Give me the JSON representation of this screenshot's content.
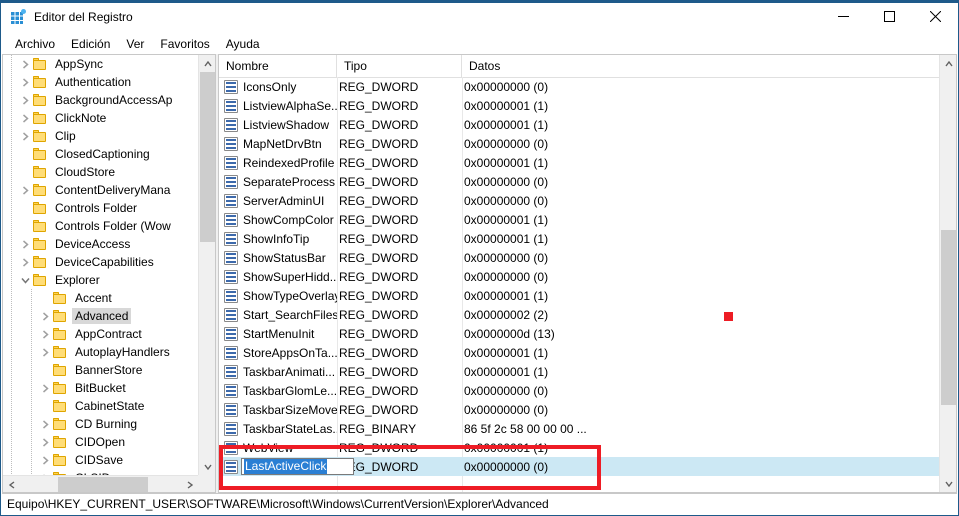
{
  "window": {
    "title": "Editor del Registro",
    "icon": "registry-editor-icon",
    "controls": {
      "minimize": "—",
      "maximize": "□",
      "close": "✕"
    }
  },
  "menu": {
    "items": [
      "Archivo",
      "Edición",
      "Ver",
      "Favoritos",
      "Ayuda"
    ]
  },
  "tree": {
    "items": [
      {
        "label": "AppSync",
        "depth": 2,
        "expandable": true,
        "expanded": false,
        "selected": false
      },
      {
        "label": "Authentication",
        "depth": 2,
        "expandable": true,
        "expanded": false,
        "selected": false
      },
      {
        "label": "BackgroundAccessAp",
        "depth": 2,
        "expandable": true,
        "expanded": false,
        "selected": false
      },
      {
        "label": "ClickNote",
        "depth": 2,
        "expandable": true,
        "expanded": false,
        "selected": false
      },
      {
        "label": "Clip",
        "depth": 2,
        "expandable": true,
        "expanded": false,
        "selected": false
      },
      {
        "label": "ClosedCaptioning",
        "depth": 2,
        "expandable": false,
        "expanded": false,
        "selected": false
      },
      {
        "label": "CloudStore",
        "depth": 2,
        "expandable": false,
        "expanded": false,
        "selected": false
      },
      {
        "label": "ContentDeliveryMana",
        "depth": 2,
        "expandable": true,
        "expanded": false,
        "selected": false
      },
      {
        "label": "Controls Folder",
        "depth": 2,
        "expandable": false,
        "expanded": false,
        "selected": false
      },
      {
        "label": "Controls Folder (Wow",
        "depth": 2,
        "expandable": false,
        "expanded": false,
        "selected": false
      },
      {
        "label": "DeviceAccess",
        "depth": 2,
        "expandable": true,
        "expanded": false,
        "selected": false
      },
      {
        "label": "DeviceCapabilities",
        "depth": 2,
        "expandable": true,
        "expanded": false,
        "selected": false
      },
      {
        "label": "Explorer",
        "depth": 2,
        "expandable": true,
        "expanded": true,
        "selected": false
      },
      {
        "label": "Accent",
        "depth": 3,
        "expandable": false,
        "expanded": false,
        "selected": false
      },
      {
        "label": "Advanced",
        "depth": 3,
        "expandable": true,
        "expanded": false,
        "selected": true
      },
      {
        "label": "AppContract",
        "depth": 3,
        "expandable": true,
        "expanded": false,
        "selected": false
      },
      {
        "label": "AutoplayHandlers",
        "depth": 3,
        "expandable": true,
        "expanded": false,
        "selected": false
      },
      {
        "label": "BannerStore",
        "depth": 3,
        "expandable": false,
        "expanded": false,
        "selected": false
      },
      {
        "label": "BitBucket",
        "depth": 3,
        "expandable": true,
        "expanded": false,
        "selected": false
      },
      {
        "label": "CabinetState",
        "depth": 3,
        "expandable": false,
        "expanded": false,
        "selected": false
      },
      {
        "label": "CD Burning",
        "depth": 3,
        "expandable": true,
        "expanded": false,
        "selected": false
      },
      {
        "label": "CIDOpen",
        "depth": 3,
        "expandable": true,
        "expanded": false,
        "selected": false
      },
      {
        "label": "CIDSave",
        "depth": 3,
        "expandable": true,
        "expanded": false,
        "selected": false
      },
      {
        "label": "CLSID",
        "depth": 3,
        "expandable": true,
        "expanded": false,
        "selected": false
      }
    ]
  },
  "list": {
    "columns": [
      "Nombre",
      "Tipo",
      "Datos"
    ],
    "rows": [
      {
        "name": "IconsOnly",
        "type": "REG_DWORD",
        "data": "0x00000000 (0)"
      },
      {
        "name": "ListviewAlphaSe...",
        "type": "REG_DWORD",
        "data": "0x00000001 (1)"
      },
      {
        "name": "ListviewShadow",
        "type": "REG_DWORD",
        "data": "0x00000001 (1)"
      },
      {
        "name": "MapNetDrvBtn",
        "type": "REG_DWORD",
        "data": "0x00000000 (0)"
      },
      {
        "name": "ReindexedProfile",
        "type": "REG_DWORD",
        "data": "0x00000001 (1)"
      },
      {
        "name": "SeparateProcess",
        "type": "REG_DWORD",
        "data": "0x00000000 (0)"
      },
      {
        "name": "ServerAdminUI",
        "type": "REG_DWORD",
        "data": "0x00000000 (0)"
      },
      {
        "name": "ShowCompColor",
        "type": "REG_DWORD",
        "data": "0x00000001 (1)"
      },
      {
        "name": "ShowInfoTip",
        "type": "REG_DWORD",
        "data": "0x00000001 (1)"
      },
      {
        "name": "ShowStatusBar",
        "type": "REG_DWORD",
        "data": "0x00000000 (0)"
      },
      {
        "name": "ShowSuperHidd...",
        "type": "REG_DWORD",
        "data": "0x00000000 (0)"
      },
      {
        "name": "ShowTypeOverlay",
        "type": "REG_DWORD",
        "data": "0x00000001 (1)"
      },
      {
        "name": "Start_SearchFiles",
        "type": "REG_DWORD",
        "data": "0x00000002 (2)"
      },
      {
        "name": "StartMenuInit",
        "type": "REG_DWORD",
        "data": "0x0000000d (13)"
      },
      {
        "name": "StoreAppsOnTa...",
        "type": "REG_DWORD",
        "data": "0x00000001 (1)"
      },
      {
        "name": "TaskbarAnimati...",
        "type": "REG_DWORD",
        "data": "0x00000001 (1)"
      },
      {
        "name": "TaskbarGlomLe...",
        "type": "REG_DWORD",
        "data": "0x00000000 (0)"
      },
      {
        "name": "TaskbarSizeMove",
        "type": "REG_DWORD",
        "data": "0x00000000 (0)"
      },
      {
        "name": "TaskbarStateLas...",
        "type": "REG_BINARY",
        "data": "86 5f 2c 58 00 00 00 ..."
      },
      {
        "name": "WebView",
        "type": "REG_DWORD",
        "data": "0x00000001 (1)"
      }
    ],
    "editing_row": {
      "name": "LastActiveClick",
      "type": "REG_DWORD",
      "data": "0x00000000 (0)",
      "selected_text": "LastActiveClick"
    }
  },
  "statusbar": {
    "path": "Equipo\\HKEY_CURRENT_USER\\SOFTWARE\\Microsoft\\Windows\\CurrentVersion\\Explorer\\Advanced"
  },
  "annotations": {
    "highlight_color": "#ee1c25",
    "marker_color": "#ed1c24"
  }
}
